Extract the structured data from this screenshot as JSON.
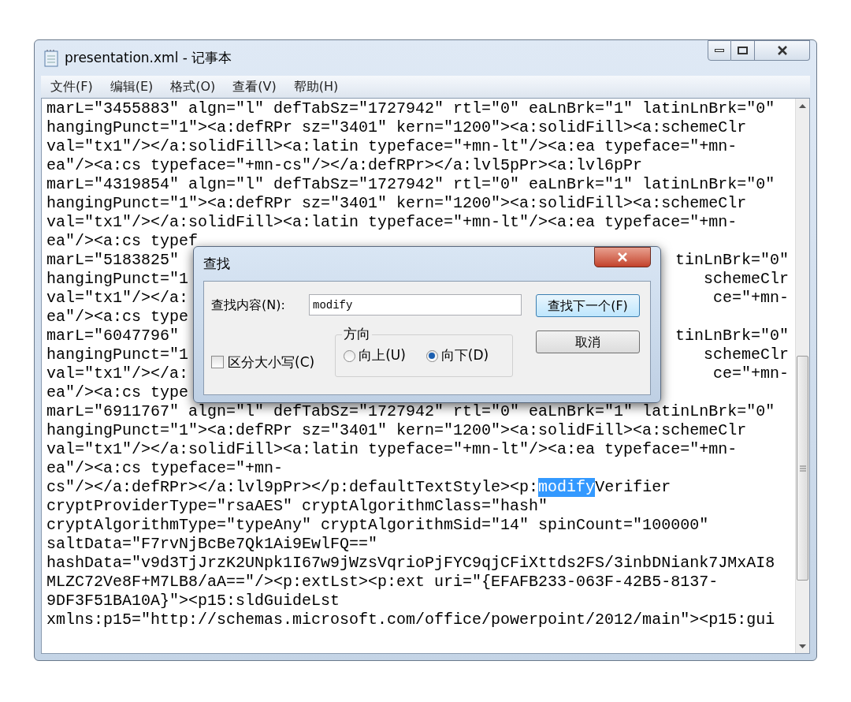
{
  "window": {
    "title": "presentation.xml - 记事本"
  },
  "menu": [
    {
      "label": "文件(F)"
    },
    {
      "label": "编辑(E)"
    },
    {
      "label": "格式(O)"
    },
    {
      "label": "查看(V)"
    },
    {
      "label": "帮助(H)"
    }
  ],
  "editor": {
    "lines": [
      {
        "kind": "plain",
        "text": "marL=\"3455883\" algn=\"l\" defTabSz=\"1727942\" rtl=\"0\" eaLnBrk=\"1\" latinLnBrk=\"0\""
      },
      {
        "kind": "plain",
        "text": "hangingPunct=\"1\"><a:defRPr sz=\"3401\" kern=\"1200\"><a:solidFill><a:schemeClr"
      },
      {
        "kind": "plain",
        "text": "val=\"tx1\"/></a:solidFill><a:latin typeface=\"+mn-lt\"/><a:ea typeface=\"+mn-"
      },
      {
        "kind": "plain",
        "text": "ea\"/><a:cs typeface=\"+mn-cs\"/></a:defRPr></a:lvl5pPr><a:lvl6pPr"
      },
      {
        "kind": "plain",
        "text": "marL=\"4319854\" algn=\"l\" defTabSz=\"1727942\" rtl=\"0\" eaLnBrk=\"1\" latinLnBrk=\"0\""
      },
      {
        "kind": "plain",
        "text": "hangingPunct=\"1\"><a:defRPr sz=\"3401\" kern=\"1200\"><a:solidFill><a:schemeClr"
      },
      {
        "kind": "plain",
        "text": "val=\"tx1\"/></a:solidFill><a:latin typeface=\"+mn-lt\"/><a:ea typeface=\"+mn-"
      },
      {
        "kind": "covered",
        "text": "ea\"/><a:cs typef"
      },
      {
        "kind": "covered",
        "text": "marL=\"5183825\"",
        "right": "tinLnBrk=\"0\""
      },
      {
        "kind": "covered",
        "text": "hangingPunct=\"1",
        "right": "schemeClr"
      },
      {
        "kind": "covered",
        "text": "val=\"tx1\"/></a:",
        "right": "ce=\"+mn-"
      },
      {
        "kind": "covered",
        "text": "ea\"/><a:cs type"
      },
      {
        "kind": "covered",
        "text": "marL=\"6047796\"",
        "right": "tinLnBrk=\"0\""
      },
      {
        "kind": "covered",
        "text": "hangingPunct=\"1",
        "right": "schemeClr"
      },
      {
        "kind": "covered",
        "text": "val=\"tx1\"/></a:",
        "right": "ce=\"+mn-"
      },
      {
        "kind": "covered",
        "text": "ea\"/><a:cs type"
      },
      {
        "kind": "plain",
        "text": "marL=\"6911767\" algn=\"l\" defTabSz=\"1727942\" rtl=\"0\" eaLnBrk=\"1\" latinLnBrk=\"0\""
      },
      {
        "kind": "plain",
        "text": "hangingPunct=\"1\"><a:defRPr sz=\"3401\" kern=\"1200\"><a:solidFill><a:schemeClr"
      },
      {
        "kind": "plain",
        "text": "val=\"tx1\"/></a:solidFill><a:latin typeface=\"+mn-lt\"/><a:ea typeface=\"+mn-"
      },
      {
        "kind": "plain",
        "text": "ea\"/><a:cs typeface=\"+mn-"
      },
      {
        "kind": "match",
        "text": "cs\"/></a:defRPr></a:lvl9pPr></p:defaultTextStyle><p:",
        "match": "modify",
        "after": "Verifier"
      },
      {
        "kind": "plain",
        "text": "cryptProviderType=\"rsaAES\" cryptAlgorithmClass=\"hash\""
      },
      {
        "kind": "plain",
        "text": "cryptAlgorithmType=\"typeAny\" cryptAlgorithmSid=\"14\" spinCount=\"100000\""
      },
      {
        "kind": "plain",
        "text": "saltData=\"F7rvNjBcBe7Qk1Ai9EwlFQ==\""
      },
      {
        "kind": "plain",
        "text": "hashData=\"v9d3TjJrzK2UNpk1I67w9jWzsVqrioPjFYC9qjCFiXttds2FS/3inbDNiank7JMxAI8"
      },
      {
        "kind": "plain",
        "text": "MLZC72Ve8F+M7LB8/aA==\"/><p:extLst><p:ext uri=\"{EFAFB233-063F-42B5-8137-"
      },
      {
        "kind": "plain",
        "text": "9DF3F51BA10A}\"><p15:sldGuideLst"
      },
      {
        "kind": "plain",
        "text": "xmlns:p15=\"http://schemas.microsoft.com/office/powerpoint/2012/main\"><p15:gui"
      }
    ]
  },
  "find_dialog": {
    "title": "查找",
    "label": "查找内容(N):",
    "value": "modify",
    "find_next": "查找下一个(F)",
    "cancel": "取消",
    "match_case": {
      "label": "区分大小写(C)",
      "checked": false
    },
    "direction": {
      "label": "方向",
      "options": [
        {
          "label": "向上(U)",
          "selected": false
        },
        {
          "label": "向下(D)",
          "selected": true
        }
      ]
    }
  }
}
